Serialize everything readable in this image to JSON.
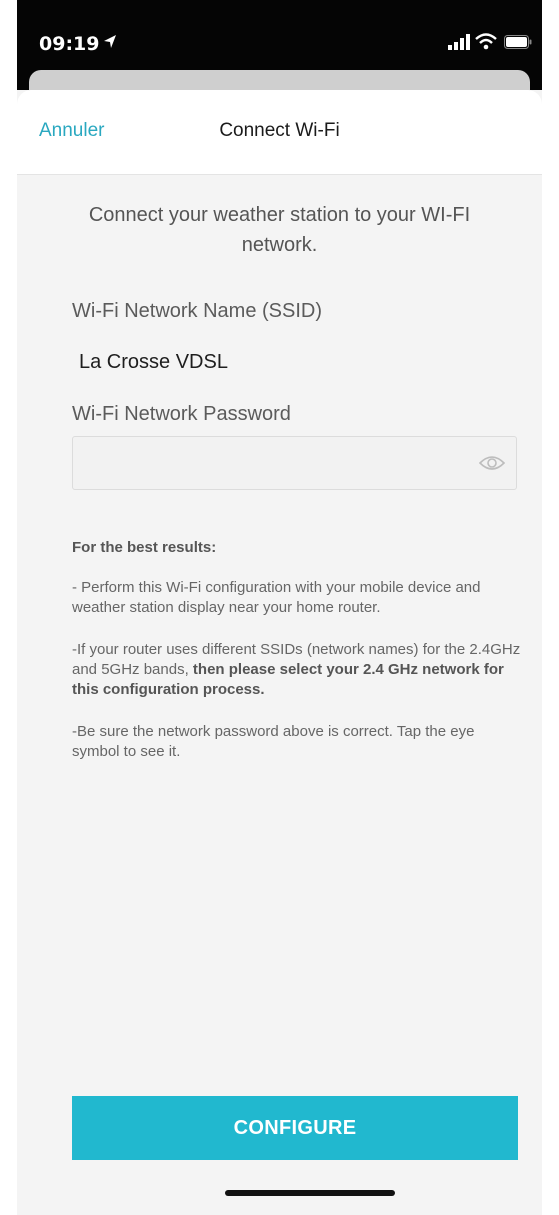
{
  "status_bar": {
    "time": "09:19",
    "icons": [
      "location-arrow-icon",
      "signal-bars-icon",
      "wifi-icon",
      "battery-icon"
    ]
  },
  "nav": {
    "cancel_label": "Annuler",
    "title": "Connect Wi-Fi"
  },
  "intro_text": "Connect your weather station to your WI-FI network.",
  "ssid": {
    "label": "Wi-Fi Network Name (SSID)",
    "value": "La Crosse VDSL"
  },
  "password": {
    "label": "Wi-Fi Network Password",
    "value": "",
    "toggle_icon": "eye-icon"
  },
  "tips": {
    "heading": "For the best results:",
    "item1": "- Perform this Wi-Fi configuration with your mobile device and weather station display near your home router.",
    "item2_plain": "-If your router uses different SSIDs (network names) for the 2.4GHz and 5GHz bands, ",
    "item2_bold": "then please select your 2.4 GHz network for this configuration process.",
    "item3": "-Be sure the network password above is correct. Tap the eye symbol to see it."
  },
  "configure_label": "CONFIGURE",
  "colors": {
    "accent": "#21b8cf",
    "link": "#2aa8c0",
    "status_bar_bg": "#050505",
    "sheet_bg": "#f4f4f4"
  }
}
